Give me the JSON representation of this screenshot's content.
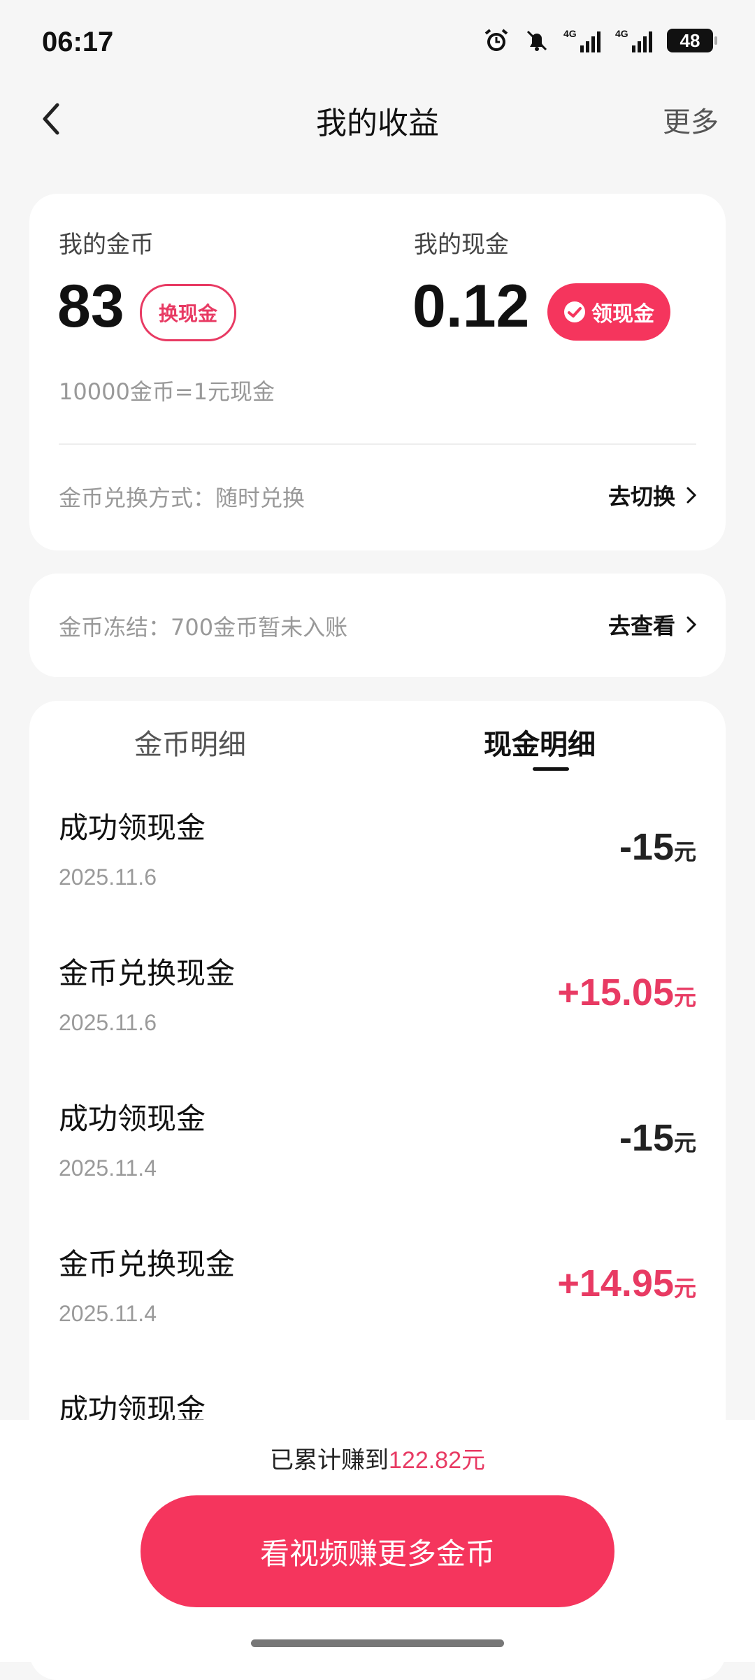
{
  "status_bar": {
    "time": "06:17",
    "network1": "4G",
    "network2": "4G",
    "battery": "48",
    "icons": [
      "alarm-icon",
      "bell-off-icon",
      "signal-icon",
      "signal-icon",
      "battery-icon"
    ]
  },
  "nav": {
    "title": "我的收益",
    "more": "更多"
  },
  "summary": {
    "coins_label": "我的金币",
    "coins_value": "83",
    "coins_button": "换现金",
    "cash_label": "我的现金",
    "cash_value": "0.12",
    "cash_button": "领现金",
    "rate_note": "10000金币=1元现金",
    "exchange_method": "金币兑换方式：随时兑换",
    "exchange_link": "去切换"
  },
  "frozen": {
    "text": "金币冻结：700金币暂未入账",
    "link": "去查看"
  },
  "tabs": {
    "coin_detail": "金币明细",
    "cash_detail": "现金明细",
    "active": "cash_detail"
  },
  "transactions": [
    {
      "title": "成功领现金",
      "date": "2025.11.6",
      "amount": "-15",
      "unit": "元",
      "type": "neg"
    },
    {
      "title": "金币兑换现金",
      "date": "2025.11.6",
      "amount": "+15.05",
      "unit": "元",
      "type": "pos"
    },
    {
      "title": "成功领现金",
      "date": "2025.11.4",
      "amount": "-15",
      "unit": "元",
      "type": "neg"
    },
    {
      "title": "金币兑换现金",
      "date": "2025.11.4",
      "amount": "+14.95",
      "unit": "元",
      "type": "pos"
    },
    {
      "title": "成功领现金",
      "date": "",
      "amount": "",
      "unit": "",
      "type": "neg"
    }
  ],
  "footer": {
    "earned_prefix": "已累计赚到",
    "earned_value": "122.82元",
    "cta": "看视频赚更多金币"
  },
  "colors": {
    "accent": "#f5355d",
    "accent_text": "#e83a63",
    "background": "#f6f6f6"
  }
}
